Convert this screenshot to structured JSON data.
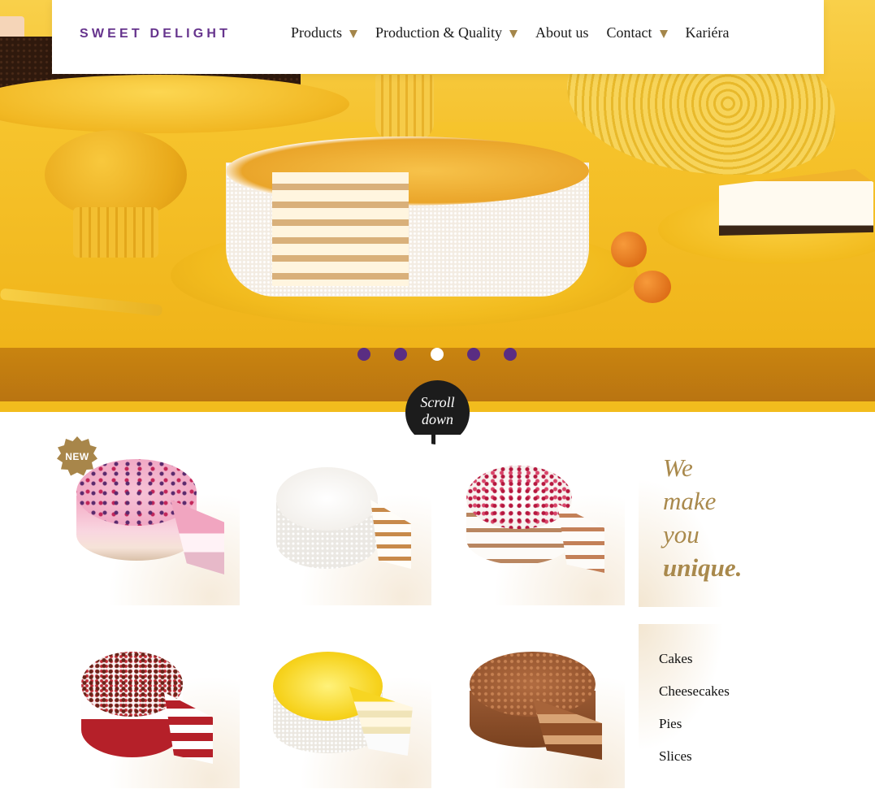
{
  "brand": {
    "name": "SWEET DELIGHT"
  },
  "nav": {
    "items": [
      {
        "label": "Products",
        "has_dropdown": true
      },
      {
        "label": "Production & Quality",
        "has_dropdown": true
      },
      {
        "label": "About us",
        "has_dropdown": false
      },
      {
        "label": "Contact",
        "has_dropdown": true
      },
      {
        "label": "Kariéra",
        "has_dropdown": false
      }
    ],
    "caret_color": "#a4864a"
  },
  "hero": {
    "slides_total": 5,
    "active_slide": 3,
    "dot_color": "#5a2d82",
    "active_dot_color": "#ffffff"
  },
  "scroll_down": {
    "line1": "Scroll",
    "line2": "down"
  },
  "products": {
    "badge": "NEW",
    "items": [
      {
        "name": "berry-mousse-cake",
        "new": true
      },
      {
        "name": "white-cream-cake",
        "new": false
      },
      {
        "name": "raspberry-cream-cake",
        "new": false
      },
      {
        "name": "red-velvet-cake",
        "new": false
      },
      {
        "name": "lemon-coconut-cake",
        "new": false
      },
      {
        "name": "chocolate-sponge-cake",
        "new": false
      }
    ]
  },
  "tagline": {
    "line1": "We",
    "line2": "make",
    "line3": "you",
    "line4": "unique.",
    "color": "#a9894c"
  },
  "categories": [
    "Cakes",
    "Cheesecakes",
    "Pies",
    "Slices"
  ],
  "colors": {
    "brand_purple": "#66348d",
    "gold": "#a8864a"
  }
}
